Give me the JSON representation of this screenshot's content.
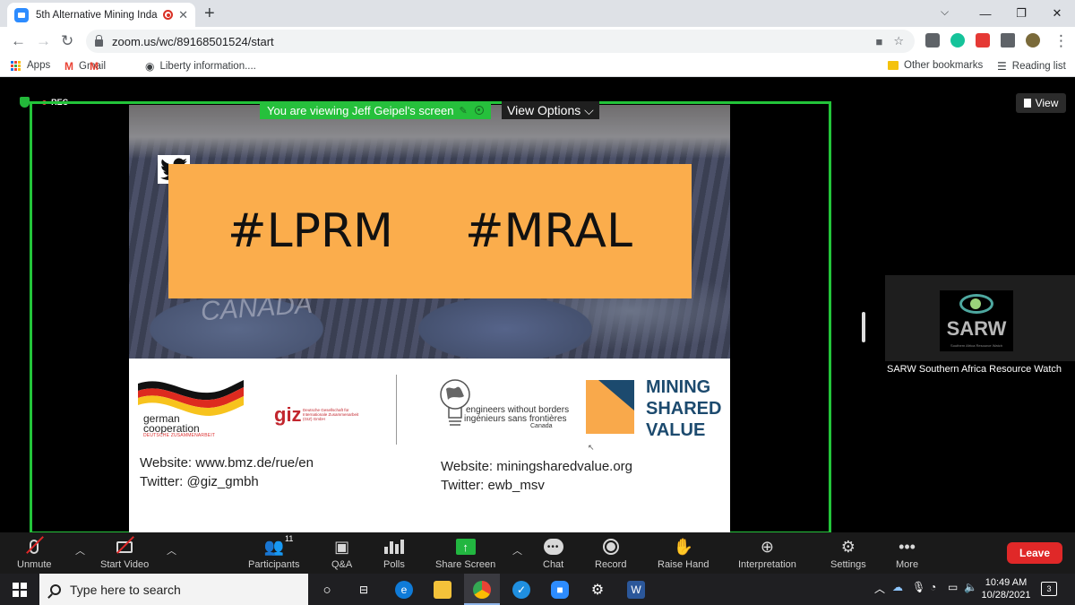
{
  "browser": {
    "tab_title": "5th Alternative Mining Inda...",
    "tab_close": "✕",
    "new_tab": "+",
    "url": "zoom.us/wc/89168501524/start",
    "bookmarks": {
      "apps": "Apps",
      "gmail": "Gmail",
      "liberty": "Liberty information....",
      "other": "Other bookmarks",
      "reading": "Reading list"
    }
  },
  "meeting": {
    "rec_label": "REC",
    "banner_text": "You are viewing Jeff Geipel's screen",
    "view_options": "View Options ⌵",
    "view_button": "View",
    "participant_name": "SARW Southern Africa Resource Watch",
    "slide": {
      "hashtag_1": "#LPRM",
      "hashtag_2": "#MRAL",
      "chalk_text": "CANADA",
      "german_coop_1": "german",
      "german_coop_2": "cooperation",
      "german_coop_sub": "DEUTSCHE ZUSAMMENARBEIT",
      "giz": "giz",
      "giz_small": "Deutsche Gesellschaft für Internationale Zusammenarbeit (GIZ) GmbH",
      "ewb_line1": "engineers without borders",
      "ewb_line2": "ingénieurs sans frontières",
      "ewb_line3": "Canada",
      "msv_1": "MINING",
      "msv_2": "SHARED",
      "msv_3": "VALUE",
      "website_left": "Website: www.bmz.de/rue/en",
      "twitter_left": "Twitter: @giz_gmbh",
      "website_right": "Website: miningsharedvalue.org",
      "twitter_right": "Twitter: ewb_msv"
    },
    "sarw_logo_text": "SARW",
    "sarw_logo_sub": "Southern Africa Resource Watch"
  },
  "toolbar": {
    "unmute": "Unmute",
    "start_video": "Start Video",
    "participants": "Participants",
    "participant_count": "11",
    "qa": "Q&A",
    "polls": "Polls",
    "share_screen": "Share Screen",
    "chat": "Chat",
    "record": "Record",
    "raise_hand": "Raise Hand",
    "interpretation": "Interpretation",
    "settings": "Settings",
    "more": "More",
    "leave": "Leave"
  },
  "taskbar": {
    "search_placeholder": "Type here to search",
    "time": "10:49 AM",
    "date": "10/28/2021",
    "notifications": "3"
  },
  "colors": {
    "zoom_green": "#23c43a",
    "leave_red": "#e02828",
    "slide_orange": "#fbad4c",
    "msv_blue": "#1c4a6e"
  }
}
